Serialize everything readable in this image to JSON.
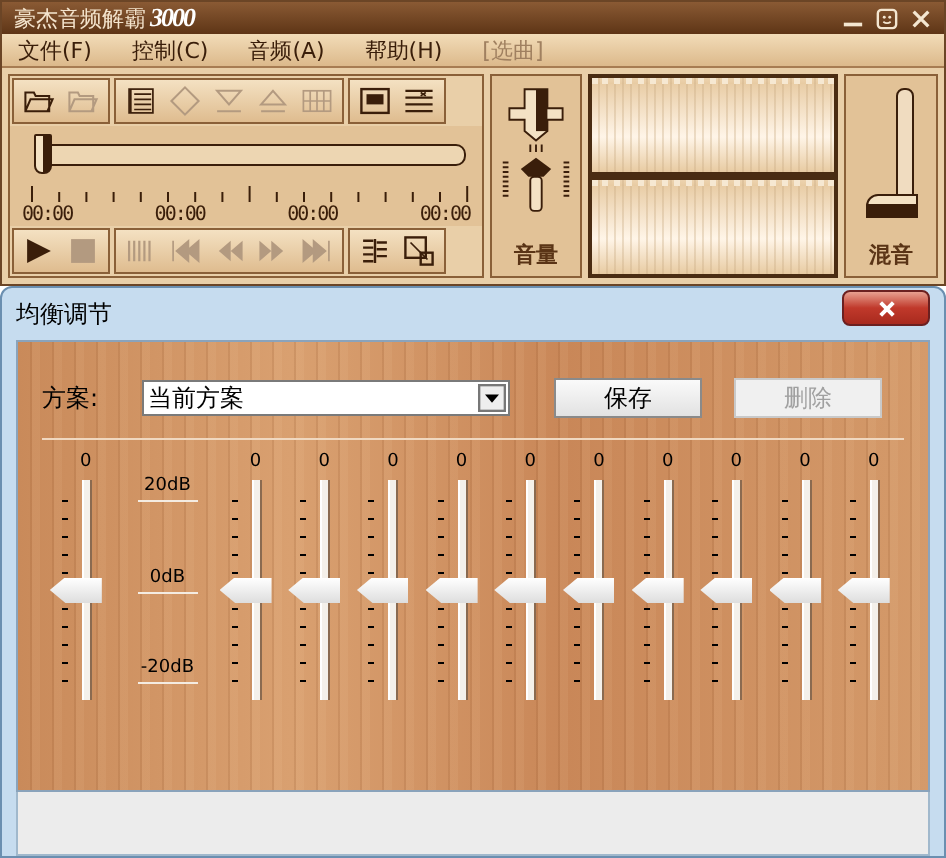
{
  "player": {
    "title": "豪杰音频解霸",
    "title_logo": "3000",
    "menu": [
      {
        "label": "文件(F)"
      },
      {
        "label": "控制(C)"
      },
      {
        "label": "音频(A)"
      },
      {
        "label": "帮助(H)"
      },
      {
        "label": "[选曲]"
      }
    ],
    "toolbar_top": [
      [
        {
          "kind": "open",
          "disabled": false
        },
        {
          "kind": "open",
          "disabled": true
        }
      ],
      [
        {
          "kind": "list",
          "disabled": false
        },
        {
          "kind": "loop",
          "disabled": true
        },
        {
          "kind": "down",
          "disabled": true
        },
        {
          "kind": "eject",
          "disabled": true
        },
        {
          "kind": "grid",
          "disabled": true
        }
      ],
      [
        {
          "kind": "screen",
          "disabled": false
        },
        {
          "kind": "panel",
          "disabled": false
        }
      ]
    ],
    "seek": {
      "level": 0
    },
    "times": [
      "00:00",
      "00:00",
      "00:00",
      "00:00"
    ],
    "toolbar_bottom": [
      [
        {
          "kind": "play",
          "disabled": false
        },
        {
          "kind": "stop",
          "disabled": true
        }
      ],
      [
        {
          "kind": "bars",
          "disabled": true
        },
        {
          "kind": "first",
          "disabled": true
        },
        {
          "kind": "rewind",
          "disabled": true
        },
        {
          "kind": "forward",
          "disabled": true
        },
        {
          "kind": "last",
          "disabled": true
        }
      ],
      [
        {
          "kind": "eq",
          "disabled": false
        },
        {
          "kind": "resize",
          "disabled": false
        }
      ]
    ],
    "volume": {
      "label": "音量"
    },
    "mix": {
      "label": "混音",
      "level": 0.1
    }
  },
  "dialog": {
    "title": "均衡调节",
    "scheme_label": "方案:",
    "scheme_value": "当前方案",
    "buttons": [
      {
        "label": "保存",
        "disabled": false
      },
      {
        "label": "删除",
        "disabled": true
      }
    ],
    "preamp": {
      "value": "0",
      "level": 0.5
    },
    "scale": [
      "20dB",
      "0dB",
      "-20dB"
    ],
    "bands": [
      {
        "value": "0",
        "level": 0.5
      },
      {
        "value": "0",
        "level": 0.5
      },
      {
        "value": "0",
        "level": 0.5
      },
      {
        "value": "0",
        "level": 0.5
      },
      {
        "value": "0",
        "level": 0.5
      },
      {
        "value": "0",
        "level": 0.5
      },
      {
        "value": "0",
        "level": 0.5
      },
      {
        "value": "0",
        "level": 0.5
      },
      {
        "value": "0",
        "level": 0.5
      },
      {
        "value": "0",
        "level": 0.5
      }
    ]
  }
}
